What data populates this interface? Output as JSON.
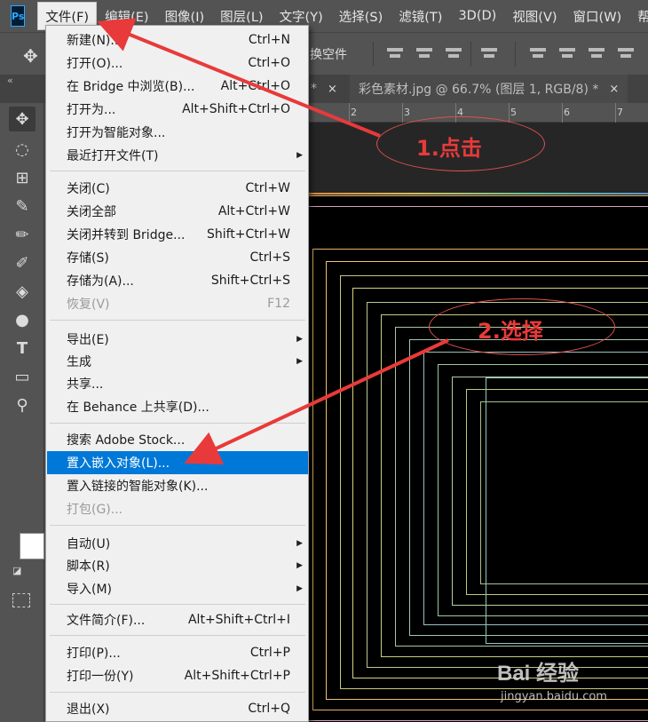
{
  "menubar": {
    "logo": "Ps",
    "items": [
      "文件(F)",
      "编辑(E)",
      "图像(I)",
      "图层(L)",
      "文字(Y)",
      "选择(S)",
      "滤镜(T)",
      "3D(D)",
      "视图(V)",
      "窗口(W)",
      "帮"
    ]
  },
  "options": {
    "text": "换空件"
  },
  "tabs": {
    "collapse": "«",
    "tab1_close": "×",
    "tab2_label": "彩色素材.jpg @ 66.7% (图层 1, RGB/8) *",
    "tab2_close": "×"
  },
  "ruler": [
    "2",
    "3",
    "4",
    "5",
    "6",
    "7"
  ],
  "file_menu": {
    "items": [
      {
        "label": "新建(N)...",
        "shortcut": "Ctrl+N"
      },
      {
        "label": "打开(O)...",
        "shortcut": "Ctrl+O"
      },
      {
        "label": "在 Bridge 中浏览(B)...",
        "shortcut": "Alt+Ctrl+O"
      },
      {
        "label": "打开为...",
        "shortcut": "Alt+Shift+Ctrl+O"
      },
      {
        "label": "打开为智能对象...",
        "shortcut": ""
      },
      {
        "label": "最近打开文件(T)",
        "shortcut": ""
      },
      {
        "label": "关闭(C)",
        "shortcut": "Ctrl+W"
      },
      {
        "label": "关闭全部",
        "shortcut": "Alt+Ctrl+W"
      },
      {
        "label": "关闭并转到 Bridge...",
        "shortcut": "Shift+Ctrl+W"
      },
      {
        "label": "存储(S)",
        "shortcut": "Ctrl+S"
      },
      {
        "label": "存储为(A)...",
        "shortcut": "Shift+Ctrl+S"
      },
      {
        "label": "恢复(V)",
        "shortcut": "F12"
      },
      {
        "label": "导出(E)",
        "shortcut": ""
      },
      {
        "label": "生成",
        "shortcut": ""
      },
      {
        "label": "共享...",
        "shortcut": ""
      },
      {
        "label": "在 Behance 上共享(D)...",
        "shortcut": ""
      },
      {
        "label": "搜索 Adobe Stock...",
        "shortcut": ""
      },
      {
        "label": "置入嵌入对象(L)...",
        "shortcut": ""
      },
      {
        "label": "置入链接的智能对象(K)...",
        "shortcut": ""
      },
      {
        "label": "打包(G)...",
        "shortcut": ""
      },
      {
        "label": "自动(U)",
        "shortcut": ""
      },
      {
        "label": "脚本(R)",
        "shortcut": ""
      },
      {
        "label": "导入(M)",
        "shortcut": ""
      },
      {
        "label": "文件简介(F)...",
        "shortcut": "Alt+Shift+Ctrl+I"
      },
      {
        "label": "打印(P)...",
        "shortcut": "Ctrl+P"
      },
      {
        "label": "打印一份(Y)",
        "shortcut": "Alt+Shift+Ctrl+P"
      },
      {
        "label": "退出(X)",
        "shortcut": "Ctrl+Q"
      }
    ]
  },
  "annotations": {
    "step1": "1.点击",
    "step2": "2.选择"
  },
  "watermark": {
    "logo": "Bai 经验",
    "url": "jingyan.baidu.com"
  },
  "colors": {
    "highlight": "#0078d7",
    "annotation": "#e83a3a",
    "menu_bg": "#f0f0f0",
    "ui_bg": "#535353"
  }
}
